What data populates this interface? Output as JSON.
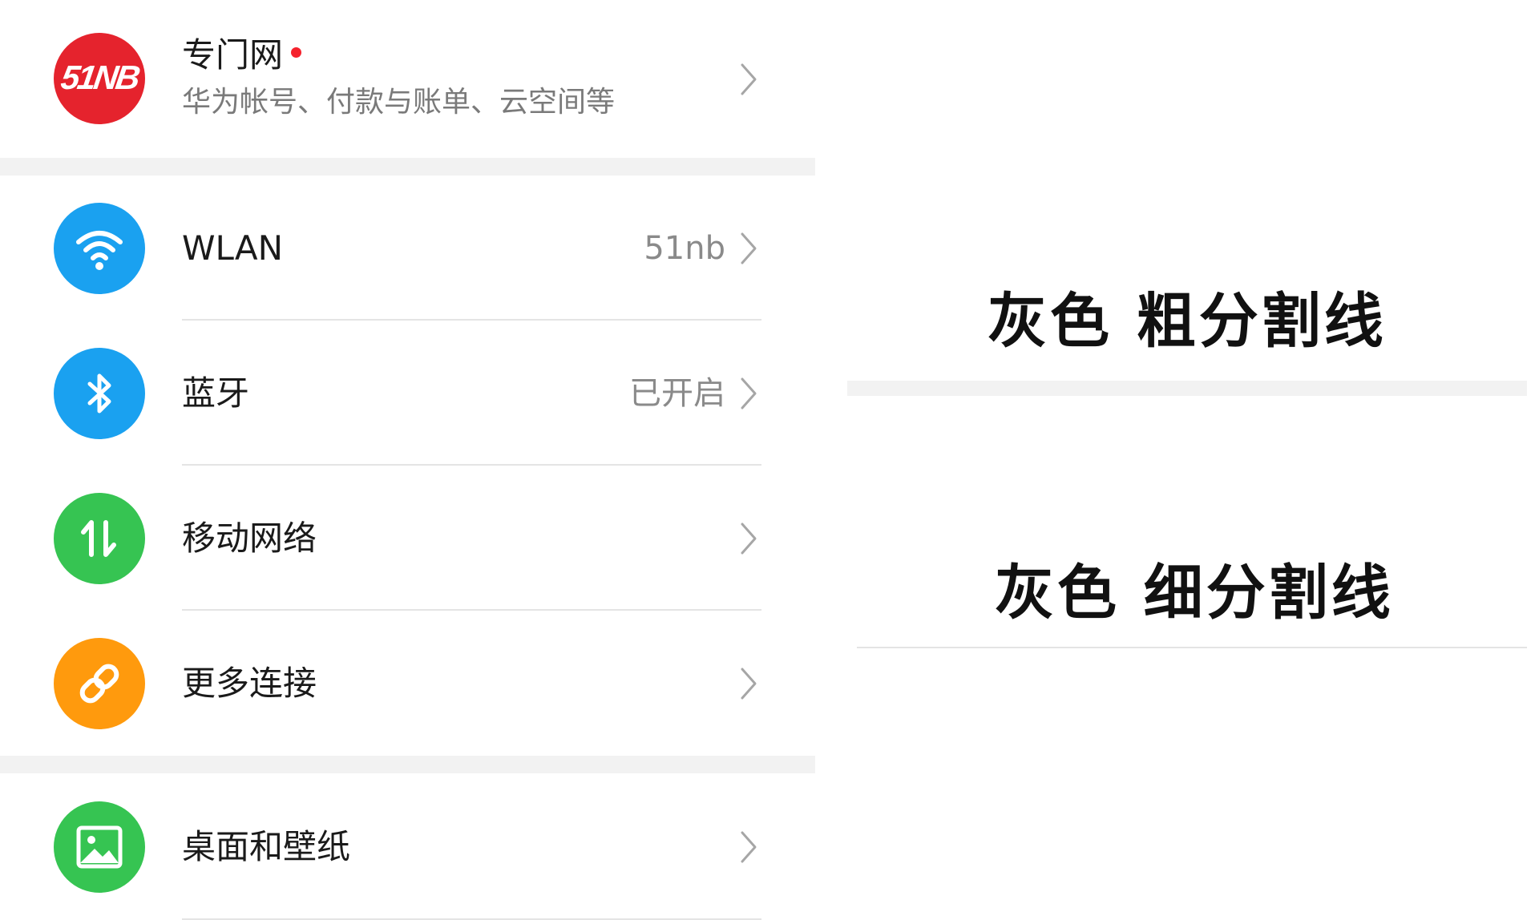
{
  "settings": {
    "account": {
      "title": "专门网",
      "subtitle": "华为帐号、付款与账单、云空间等",
      "logo_text": "51NB",
      "has_notification_dot": true
    },
    "connectivity": [
      {
        "id": "wlan",
        "title": "WLAN",
        "value": "51nb",
        "icon": "wifi-icon",
        "color": "#1aa1f0"
      },
      {
        "id": "bluetooth",
        "title": "蓝牙",
        "value": "已开启",
        "icon": "bluetooth-icon",
        "color": "#1aa1f0"
      },
      {
        "id": "mobile-network",
        "title": "移动网络",
        "value": "",
        "icon": "mobile-data-icon",
        "color": "#36c452"
      },
      {
        "id": "more-connections",
        "title": "更多连接",
        "value": "",
        "icon": "link-icon",
        "color": "#ff9a0d"
      }
    ],
    "display": [
      {
        "id": "home-wallpaper",
        "title": "桌面和壁纸",
        "value": "",
        "icon": "image-icon",
        "color": "#36c452"
      }
    ]
  },
  "legend": {
    "thick_divider_label": "灰色 粗分割线",
    "thin_divider_label": "灰色 细分割线"
  },
  "colors": {
    "logo_red": "#e5232d",
    "thick_divider": "#f2f2f2",
    "thin_divider": "#e4e4e4",
    "chevron": "#a6a6a6"
  }
}
